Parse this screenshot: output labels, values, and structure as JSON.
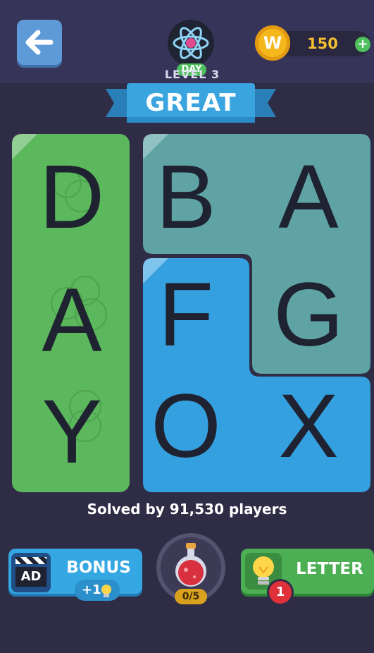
{
  "header": {
    "back_icon": "arrow-left-icon",
    "level_icon": "atom-icon",
    "day_badge": "DAY",
    "level_label": "LEVEL 3",
    "coins": {
      "icon": "coin-w-icon",
      "coin_letter": "W",
      "count": "150",
      "add_label": "+"
    }
  },
  "banner": {
    "text": "GREAT"
  },
  "board": {
    "columns": 3,
    "rows": 3,
    "letters": [
      "D",
      "B",
      "A",
      "A",
      "F",
      "G",
      "Y",
      "O",
      "X"
    ],
    "regions": [
      {
        "name": "green",
        "color": "#5cb85c",
        "cells": [
          "D",
          "A",
          "Y"
        ],
        "solved": true
      },
      {
        "name": "teal",
        "color": "#5fa3a5",
        "cells": [
          "B",
          "A",
          "G"
        ],
        "solved": false
      },
      {
        "name": "blue",
        "color": "#35a0df",
        "cells": [
          "F",
          "O",
          "X"
        ],
        "solved": false
      }
    ]
  },
  "status": {
    "solved_text": "Solved by 91,530 players"
  },
  "footer": {
    "bonus": {
      "label": "BONUS",
      "reward": "+1",
      "ad_label": "AD",
      "icon": "clapperboard-icon"
    },
    "potion": {
      "progress": "0/5",
      "icon": "potion-icon"
    },
    "letter": {
      "label": "LETTER",
      "badge": "1",
      "icon": "lightbulb-icon"
    }
  },
  "colors": {
    "background": "#2f2c46",
    "green_tile": "#5cb85c",
    "teal_tile": "#5fa3a5",
    "blue_tile": "#35a0df",
    "coin": "#f5b81c",
    "banner": "#3aa4df"
  }
}
